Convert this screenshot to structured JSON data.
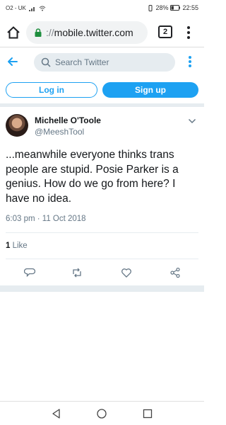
{
  "statusbar": {
    "carrier": "O2 - UK",
    "battery": "28%",
    "time": "22:55"
  },
  "browser": {
    "url_scheme": "://",
    "url_host": "mobile.twitter.com",
    "tab_count": "2"
  },
  "twitter_header": {
    "search_placeholder": "Search Twitter"
  },
  "auth": {
    "login_label": "Log in",
    "signup_label": "Sign up"
  },
  "tweet": {
    "author_name": "Michelle O'Toole",
    "author_handle": "@MeeshTool",
    "text": "...meanwhile everyone thinks trans people are stupid. Posie Parker is a genius. How do we go from here? I have no idea.",
    "timestamp": "6:03 pm · 11 Oct 2018",
    "like_count": "1",
    "like_label": " Like"
  },
  "colors": {
    "accent": "#1da1f2",
    "muted": "#657786",
    "separator": "#e6ecf0"
  },
  "icons": {
    "actions": [
      "reply-icon",
      "retweet-icon",
      "like-icon",
      "share-icon"
    ],
    "nav": [
      "back-nav-icon",
      "home-nav-icon",
      "recents-nav-icon"
    ]
  }
}
